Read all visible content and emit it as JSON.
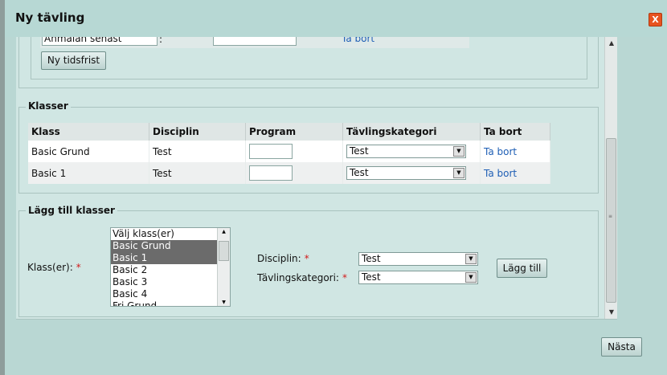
{
  "window": {
    "title": "Ny tävling",
    "close_label": "X"
  },
  "deadline": {
    "row_label": "Anmälan senast",
    "separator": ":",
    "remove_link": "Ta bort",
    "new_deadline_button": "Ny tidsfrist"
  },
  "classes": {
    "legend": "Klasser",
    "headers": [
      "Klass",
      "Disciplin",
      "Program",
      "Tävlingskategori",
      "Ta bort"
    ],
    "rows": [
      {
        "klass": "Basic Grund",
        "disciplin": "Test",
        "program": "",
        "kategori": "Test",
        "remove": "Ta bort"
      },
      {
        "klass": "Basic 1",
        "disciplin": "Test",
        "program": "",
        "kategori": "Test",
        "remove": "Ta bort"
      }
    ]
  },
  "add_classes": {
    "legend": "Lägg till klasser",
    "classes_label": "Klass(er):",
    "required_mark": "*",
    "listbox_items": [
      {
        "label": "Välj klass(er)",
        "selected": false
      },
      {
        "label": "Basic Grund",
        "selected": true
      },
      {
        "label": "Basic 1",
        "selected": true
      },
      {
        "label": "Basic 2",
        "selected": false
      },
      {
        "label": "Basic 3",
        "selected": false
      },
      {
        "label": "Basic 4",
        "selected": false
      },
      {
        "label": "Fri Grund",
        "selected": false
      }
    ],
    "discipline_label": "Disciplin:",
    "discipline_value": "Test",
    "category_label": "Tävlingskategori:",
    "category_value": "Test",
    "add_button": "Lägg till"
  },
  "footer": {
    "next_button": "Nästa"
  }
}
